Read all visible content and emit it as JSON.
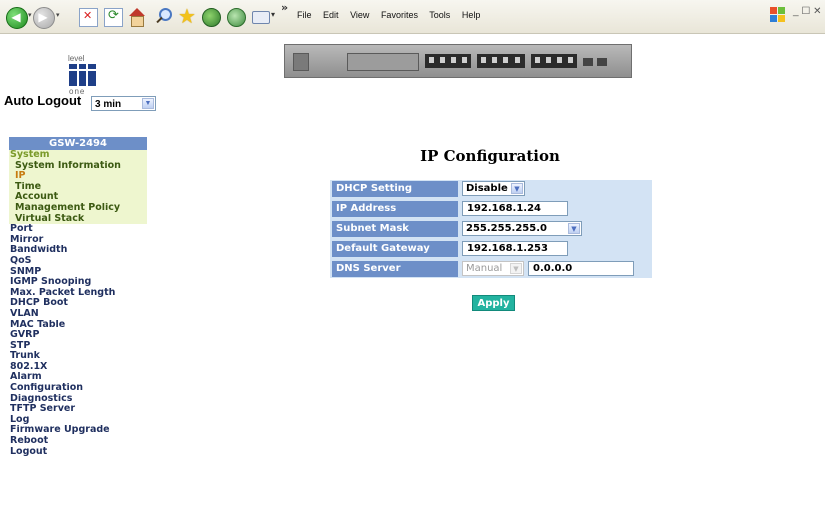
{
  "browser": {
    "menu": [
      "File",
      "Edit",
      "View",
      "Favorites",
      "Tools",
      "Help"
    ],
    "icons": [
      "back-icon",
      "forward-icon",
      "stop-icon",
      "refresh-icon",
      "home-icon",
      "search-icon",
      "favorites-star-icon",
      "media-icon",
      "history-icon",
      "mail-icon",
      "windows-logo-icon"
    ]
  },
  "logo": {
    "top_text": "level",
    "bottom_text": "one"
  },
  "auto_logout": {
    "label": "Auto Logout",
    "value": "3 min"
  },
  "nav": {
    "header": "GSW-2494",
    "items": [
      {
        "label": "System",
        "level": "section"
      },
      {
        "label": "System Information",
        "level": "sub"
      },
      {
        "label": "IP",
        "level": "sub",
        "active": true
      },
      {
        "label": "Time",
        "level": "sub"
      },
      {
        "label": "Account",
        "level": "sub"
      },
      {
        "label": "Management Policy",
        "level": "sub"
      },
      {
        "label": "Virtual Stack",
        "level": "sub"
      },
      {
        "label": "Port",
        "level": "top"
      },
      {
        "label": "Mirror",
        "level": "top"
      },
      {
        "label": "Bandwidth",
        "level": "top"
      },
      {
        "label": "QoS",
        "level": "top"
      },
      {
        "label": "SNMP",
        "level": "top"
      },
      {
        "label": "IGMP Snooping",
        "level": "top"
      },
      {
        "label": "Max. Packet Length",
        "level": "top"
      },
      {
        "label": "DHCP Boot",
        "level": "top"
      },
      {
        "label": "VLAN",
        "level": "top"
      },
      {
        "label": "MAC Table",
        "level": "top"
      },
      {
        "label": "GVRP",
        "level": "top"
      },
      {
        "label": "STP",
        "level": "top"
      },
      {
        "label": "Trunk",
        "level": "top"
      },
      {
        "label": "802.1X",
        "level": "top"
      },
      {
        "label": "Alarm",
        "level": "top"
      },
      {
        "label": "Configuration",
        "level": "top"
      },
      {
        "label": "Diagnostics",
        "level": "top"
      },
      {
        "label": "TFTP Server",
        "level": "top"
      },
      {
        "label": "Log",
        "level": "top"
      },
      {
        "label": "Firmware Upgrade",
        "level": "top"
      },
      {
        "label": "Reboot",
        "level": "top"
      },
      {
        "label": "Logout",
        "level": "top"
      }
    ]
  },
  "page": {
    "title": "IP Configuration",
    "fields": {
      "dhcp": {
        "label": "DHCP Setting",
        "value": "Disable"
      },
      "ip": {
        "label": "IP Address",
        "value": "192.168.1.24"
      },
      "mask": {
        "label": "Subnet Mask",
        "value": "255.255.255.0"
      },
      "gateway": {
        "label": "Default Gateway",
        "value": "192.168.1.253"
      },
      "dns": {
        "label": "DNS Server",
        "mode": "Manual",
        "value": "0.0.0.0"
      }
    },
    "apply_label": "Apply"
  },
  "colors": {
    "nav_header": "#6d8fc8",
    "label_bg": "#6d8fc8",
    "form_bg": "#d3e3f4",
    "submenu_bg": "#eef6cf",
    "active_item": "#c77b10",
    "apply_button": "#23b3a0"
  }
}
